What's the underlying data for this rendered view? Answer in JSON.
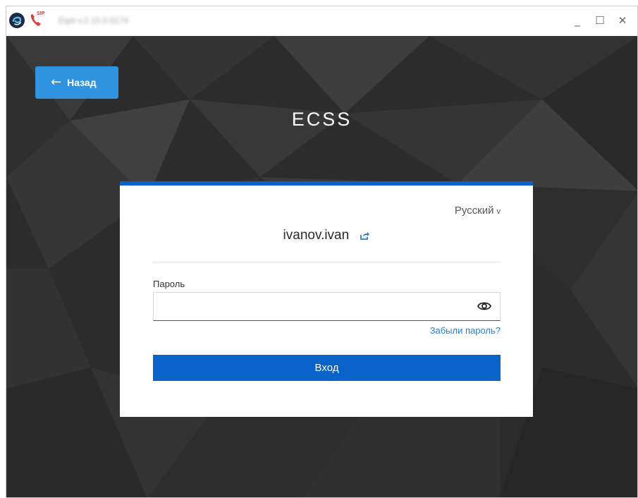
{
  "window": {
    "title": "Eqst v.2.15.0.0174",
    "controls": {
      "minimize": "_",
      "maximize": "☐",
      "close": "✕"
    },
    "sip_badge": "SIP"
  },
  "nav": {
    "back_label": "Назад"
  },
  "brand": {
    "title": "ECSS"
  },
  "login": {
    "language": "Русский",
    "language_chevron": "v",
    "username": "ivanov.ivan",
    "password_label": "Пароль",
    "password_value": "",
    "forgot_label": "Забыли пароль?",
    "submit_label": "Вход"
  },
  "colors": {
    "accent": "#0a63c9",
    "back_button": "#2f93e0",
    "link": "#2a7ec8",
    "background": "#2b2b2b"
  },
  "icons": [
    "app-logo-icon",
    "sip-phone-icon",
    "arrow-left-icon",
    "edit-user-icon",
    "eye-icon"
  ]
}
